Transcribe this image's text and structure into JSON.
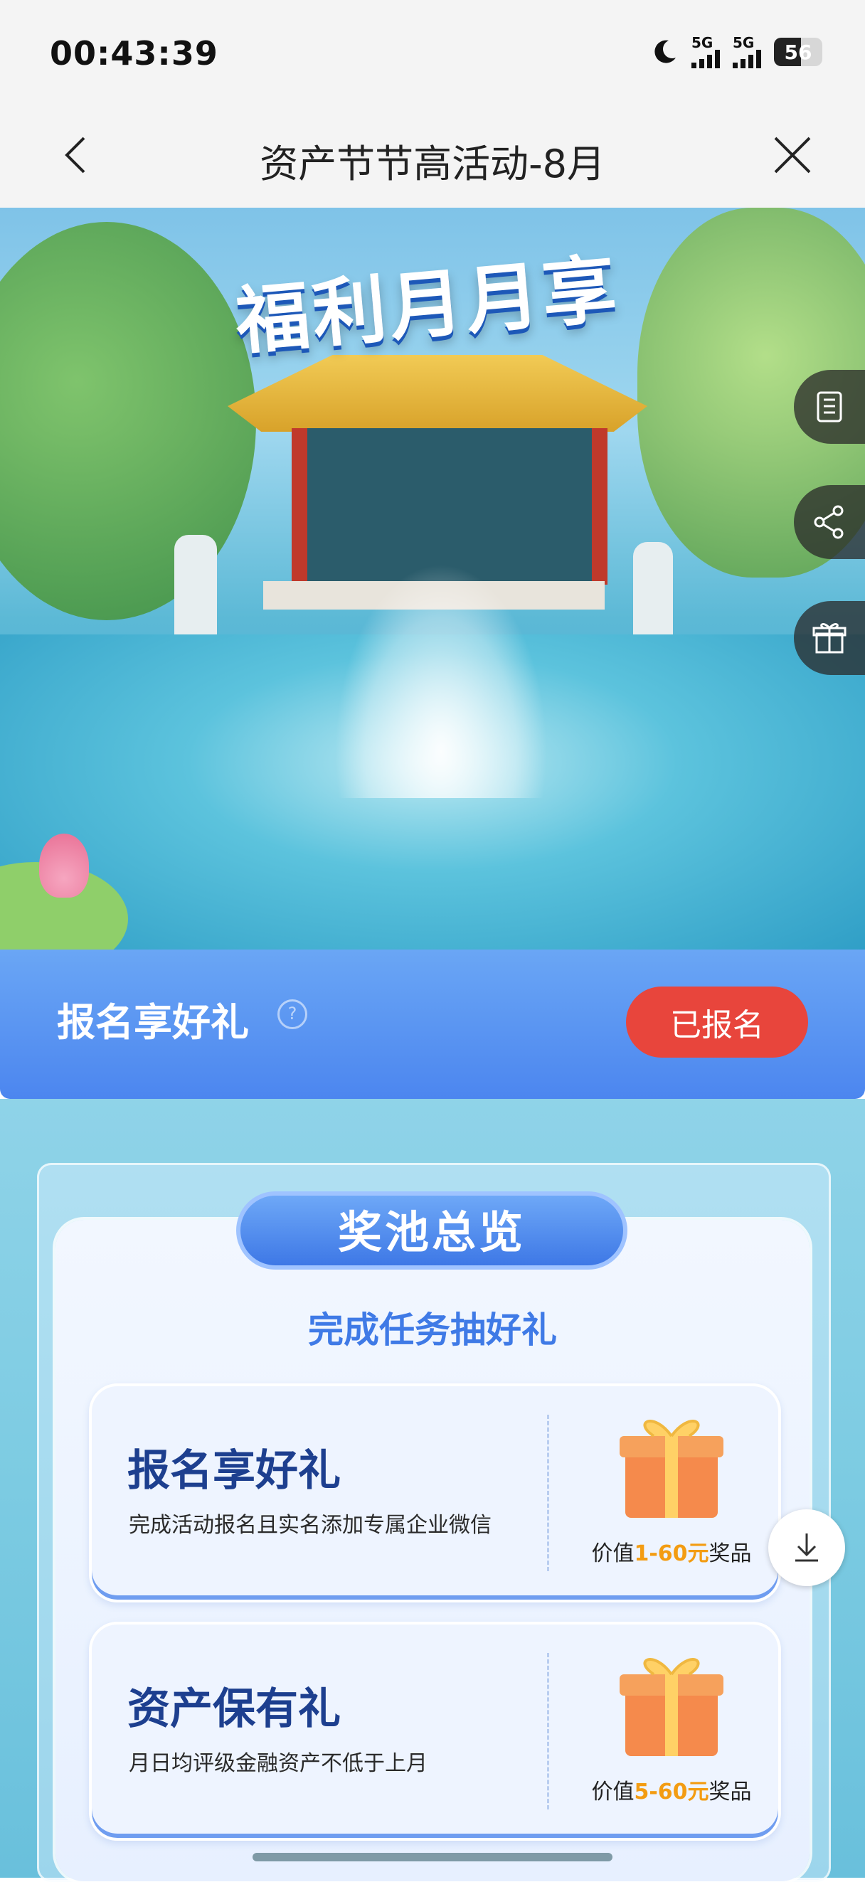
{
  "status_bar": {
    "time": "00:43:39",
    "signal1_label": "5G",
    "signal2_label": "5G",
    "battery": "56",
    "battery_level_percent": 56
  },
  "nav": {
    "title": "资产节节高活动-8月"
  },
  "hero": {
    "title": "福利月月享"
  },
  "signup": {
    "title": "报名享好礼",
    "help": "?",
    "button": "已报名"
  },
  "pool": {
    "title": "奖池总览",
    "subtitle": "完成任务抽好礼",
    "tasks": [
      {
        "name": "报名享好礼",
        "desc": "完成活动报名且实名添加专属企业微信",
        "prize_prefix": "价值",
        "prize_amount": "1-60元",
        "prize_suffix": "奖品"
      },
      {
        "name": "资产保有礼",
        "desc": "月日均评级金融资产不低于上月",
        "prize_prefix": "价值",
        "prize_amount": "5-60元",
        "prize_suffix": "奖品"
      }
    ]
  },
  "colors": {
    "signup_bar": "#5a92f2",
    "signup_button": "#e8453c",
    "pool_title": "#4a85ed",
    "task_name": "#1d3f8f",
    "prize_amount": "#f39c12"
  },
  "icons": [
    "moon-icon",
    "signal-icon",
    "battery-icon",
    "back-arrow-icon",
    "close-icon",
    "document-icon",
    "share-icon",
    "gift-icon",
    "download-icon",
    "help-icon"
  ]
}
